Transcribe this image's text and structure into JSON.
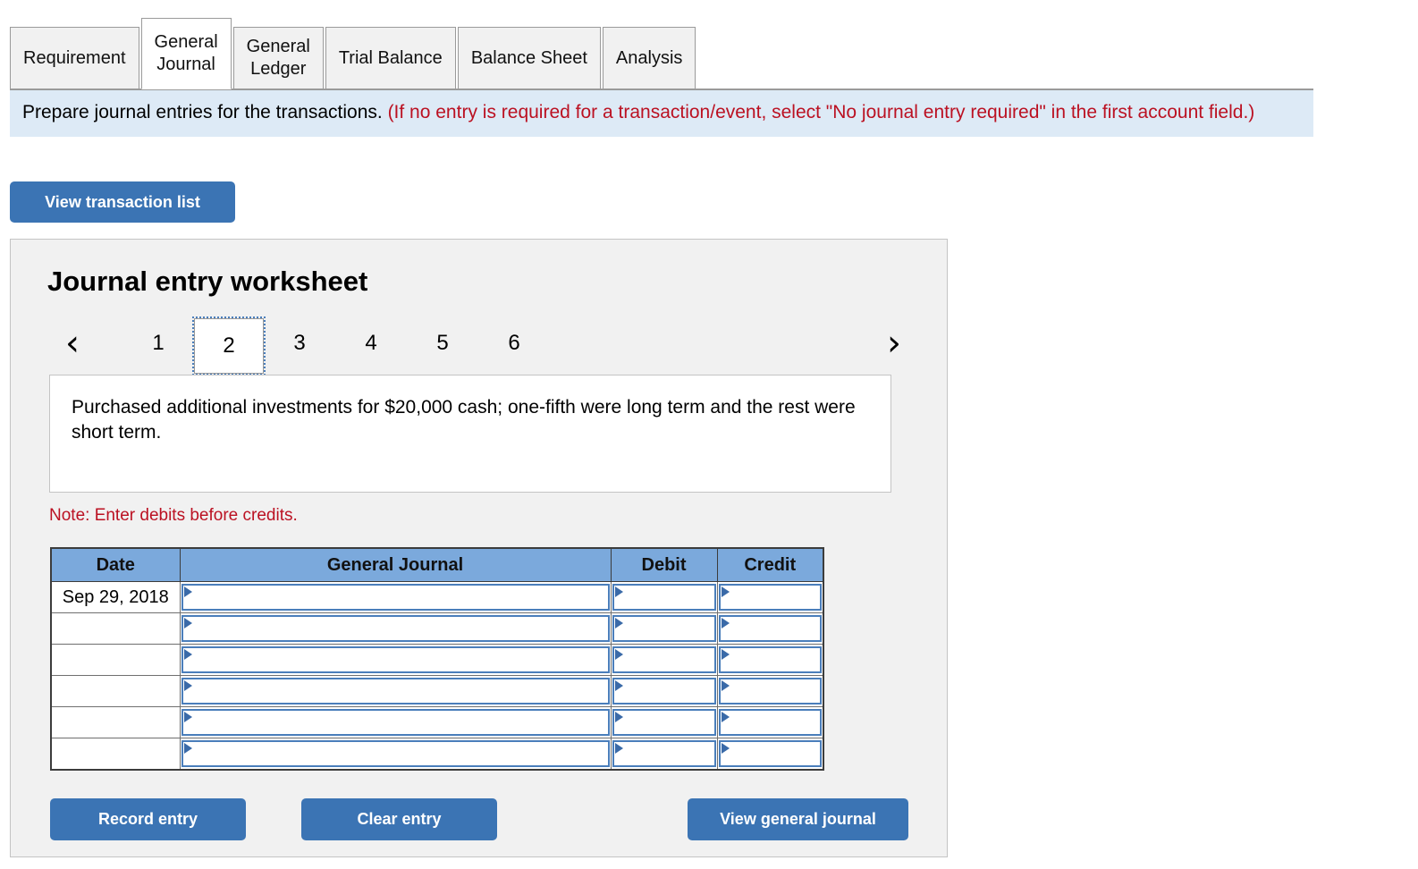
{
  "tabs": [
    {
      "label": "Requirement",
      "active": false
    },
    {
      "label": "General\nJournal",
      "active": true
    },
    {
      "label": "General\nLedger",
      "active": false
    },
    {
      "label": "Trial Balance",
      "active": false
    },
    {
      "label": "Balance Sheet",
      "active": false
    },
    {
      "label": "Analysis",
      "active": false
    }
  ],
  "banner": {
    "main": "Prepare journal entries for the transactions.",
    "hint": "(If no entry is required for a transaction/event, select \"No journal entry required\" in the first account field.)"
  },
  "toolbar": {
    "view_transaction_list_label": "View transaction list"
  },
  "worksheet": {
    "title": "Journal entry worksheet",
    "pager": {
      "prev_icon": "chevron-left-icon",
      "next_icon": "chevron-right-icon",
      "prev_glyph": "‹",
      "next_glyph": "›",
      "pages": [
        "1",
        "2",
        "3",
        "4",
        "5",
        "6"
      ],
      "active_page": "2"
    },
    "transaction_text": "Purchased additional investments for $20,000 cash; one-fifth were long term and the rest were short term.",
    "note": "Note: Enter debits before credits.",
    "table": {
      "headers": [
        "Date",
        "General Journal",
        "Debit",
        "Credit"
      ],
      "rows": [
        {
          "date": "Sep 29, 2018",
          "general_journal": "",
          "debit": "",
          "credit": ""
        },
        {
          "date": "",
          "general_journal": "",
          "debit": "",
          "credit": ""
        },
        {
          "date": "",
          "general_journal": "",
          "debit": "",
          "credit": ""
        },
        {
          "date": "",
          "general_journal": "",
          "debit": "",
          "credit": ""
        },
        {
          "date": "",
          "general_journal": "",
          "debit": "",
          "credit": ""
        },
        {
          "date": "",
          "general_journal": "",
          "debit": "",
          "credit": ""
        }
      ]
    },
    "actions": {
      "record_entry_label": "Record entry",
      "clear_entry_label": "Clear entry",
      "view_general_journal_label": "View general journal"
    }
  },
  "colors": {
    "accent_blue": "#3b74b4",
    "banner_bg": "#ddeaf6",
    "table_header_blue": "#7ba9dc",
    "input_border_blue": "#4a7ebb",
    "warning_red": "#bb1122",
    "panel_bg": "#f1f1f1"
  }
}
